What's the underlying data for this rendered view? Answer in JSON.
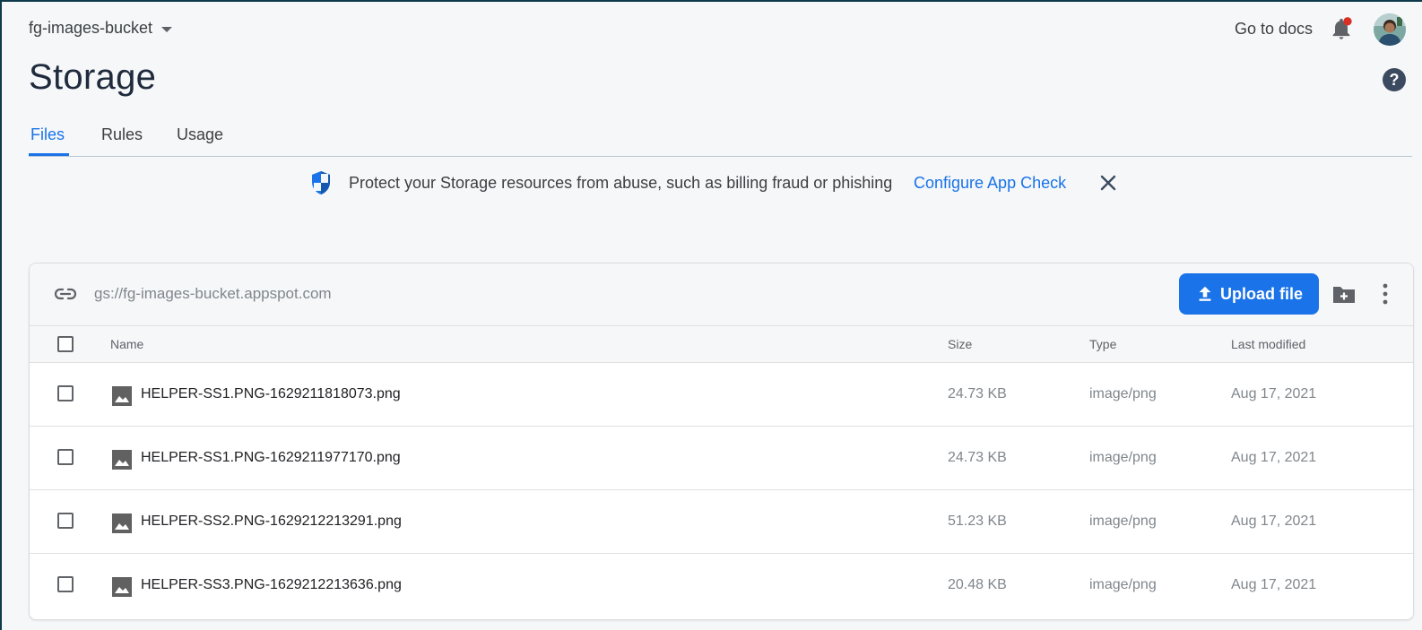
{
  "header": {
    "project": "fg-images-bucket",
    "docs_label": "Go to docs",
    "page_title": "Storage"
  },
  "tabs": [
    {
      "label": "Files",
      "active": true
    },
    {
      "label": "Rules",
      "active": false
    },
    {
      "label": "Usage",
      "active": false
    }
  ],
  "banner": {
    "text": "Protect your Storage resources from abuse, such as billing fraud or phishing",
    "link": "Configure App Check"
  },
  "toolbar": {
    "bucket_path": "gs://fg-images-bucket.appspot.com",
    "upload_label": "Upload file"
  },
  "table": {
    "columns": [
      "Name",
      "Size",
      "Type",
      "Last modified"
    ],
    "rows": [
      {
        "name": "HELPER-SS1.PNG-1629211818073.png",
        "size": "24.73 KB",
        "type": "image/png",
        "modified": "Aug 17, 2021"
      },
      {
        "name": "HELPER-SS1.PNG-1629211977170.png",
        "size": "24.73 KB",
        "type": "image/png",
        "modified": "Aug 17, 2021"
      },
      {
        "name": "HELPER-SS2.PNG-1629212213291.png",
        "size": "51.23 KB",
        "type": "image/png",
        "modified": "Aug 17, 2021"
      },
      {
        "name": "HELPER-SS3.PNG-1629212213636.png",
        "size": "20.48 KB",
        "type": "image/png",
        "modified": "Aug 17, 2021"
      }
    ]
  },
  "icons": {
    "notification": "bell-icon",
    "help": "help-icon",
    "shield": "shield-icon",
    "close": "close-icon",
    "link": "link-icon",
    "upload": "upload-icon",
    "new_folder": "folder-add-icon",
    "more": "more-vert-icon",
    "file": "image-file-icon"
  },
  "colors": {
    "accent": "#1a73e8",
    "notification_dot": "#d93025",
    "background": "#f5f7f9"
  }
}
